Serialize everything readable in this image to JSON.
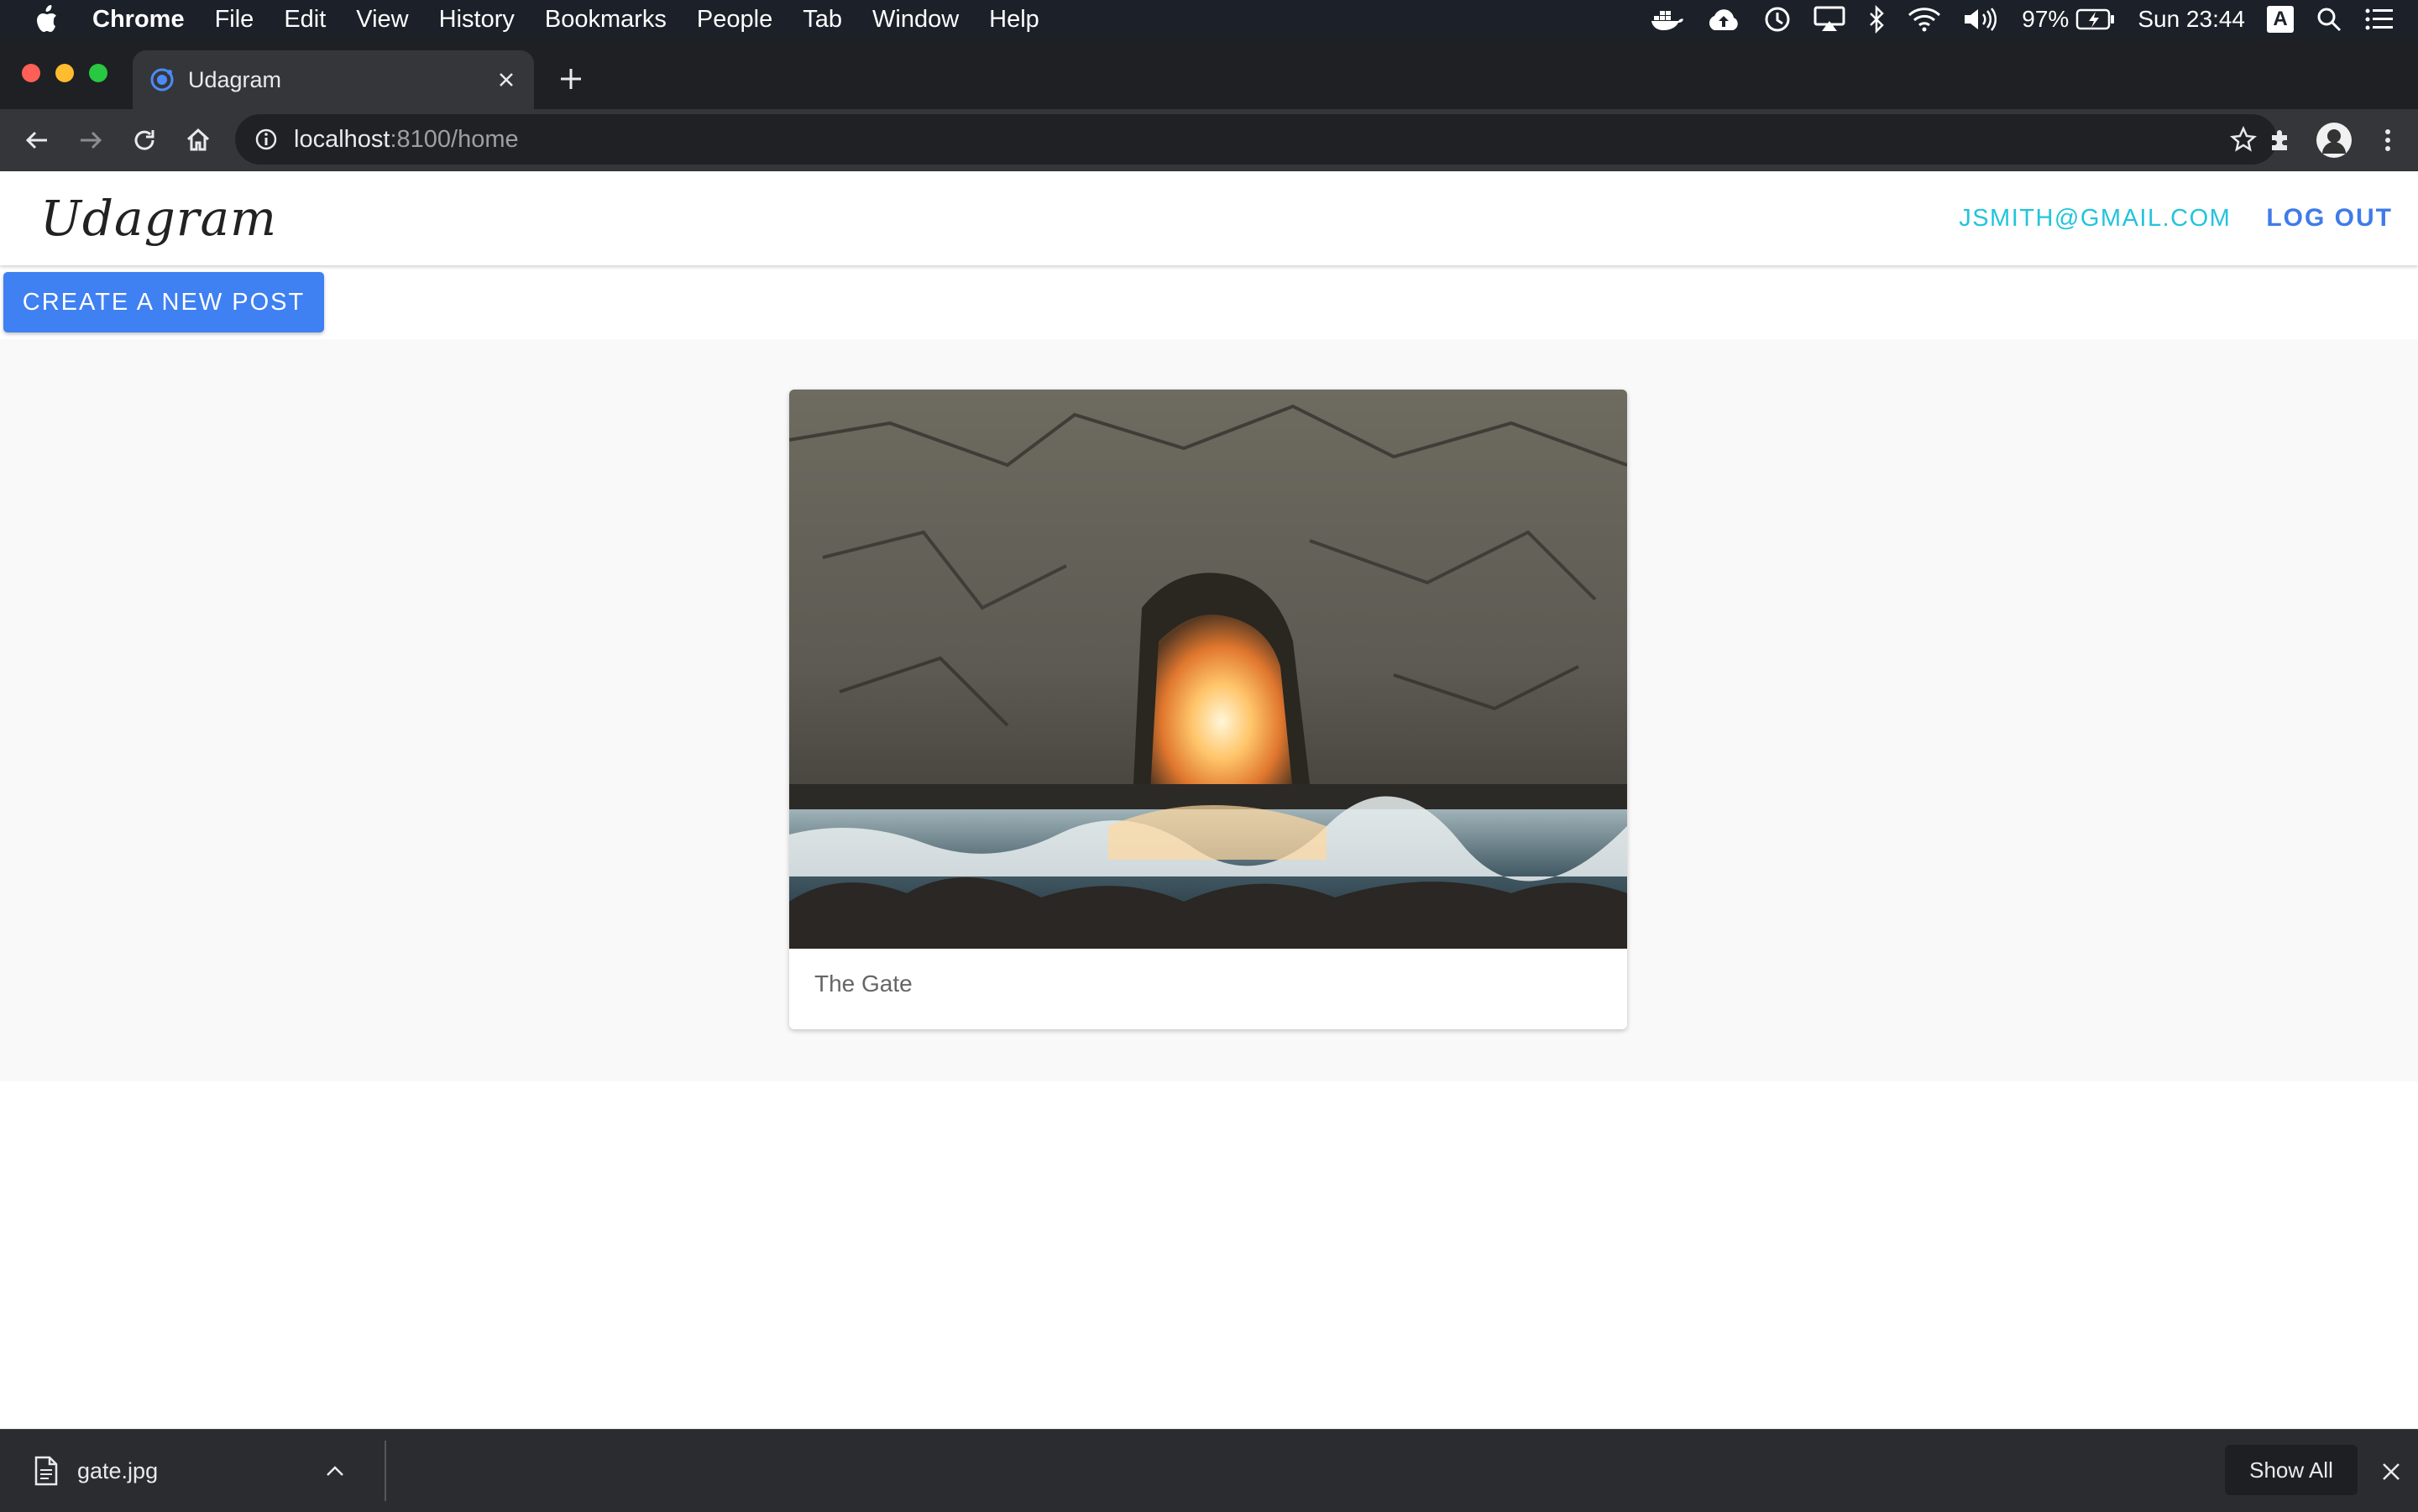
{
  "menubar": {
    "app_name": "Chrome",
    "items": [
      "File",
      "Edit",
      "View",
      "History",
      "Bookmarks",
      "People",
      "Tab",
      "Window",
      "Help"
    ],
    "battery": "97%",
    "clock": "Sun 23:44",
    "input_source": "A"
  },
  "browser": {
    "tab_title": "Udagram",
    "url_host": "localhost",
    "url_path": ":8100/home"
  },
  "app": {
    "logo": "Udagram",
    "user_email": "JSMITH@GMAIL.COM",
    "logout_label": "LOG OUT",
    "create_post_label": "CREATE A NEW POST",
    "posts": [
      {
        "caption": "The Gate"
      }
    ]
  },
  "downloads": {
    "file_name": "gate.jpg",
    "show_all_label": "Show All"
  },
  "colors": {
    "accent_blue": "#3f80f2",
    "email_cyan": "#22c4dc",
    "logout_blue": "#3f7be8"
  }
}
